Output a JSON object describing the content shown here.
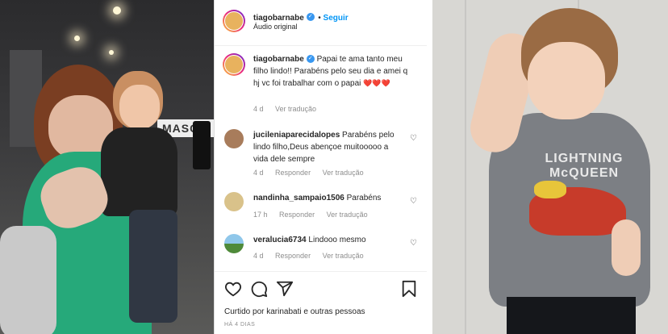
{
  "header": {
    "username": "tiagobarnabe",
    "follow_label": "Seguir",
    "audio_label": "Áudio original"
  },
  "caption": {
    "username": "tiagobarnabe",
    "text": "Papai te ama tanto meu filho lindo!! Parabéns pelo seu dia e amei q hj vc foi trabalhar com o papai",
    "hearts": "❤️❤️❤️",
    "time": "4 d",
    "translate_label": "Ver tradução"
  },
  "comments": [
    {
      "username": "jucileniaparecidalopes",
      "text": "Parabéns pelo lindo filho,Deus abençoe muitooooo a vida dele sempre",
      "time": "4 d",
      "reply_label": "Responder",
      "translate_label": "Ver tradução"
    },
    {
      "username": "nandinha_sampaio1506",
      "text": "Parabéns",
      "time": "17 h",
      "reply_label": "Responder",
      "translate_label": "Ver tradução"
    },
    {
      "username": "veralucia6734",
      "text": "Lindooo mesmo",
      "time": "4 d",
      "reply_label": "Responder",
      "translate_label": "Ver tradução"
    }
  ],
  "footer": {
    "likes_text": "Curtido por karinabati e outras pessoas",
    "date_text": "HÁ 4 DIAS"
  },
  "left_photo": {
    "sign_text": "MASCU"
  },
  "right_photo": {
    "shirt_line1": "LIGHTNING",
    "shirt_line2": "McQUEEN"
  },
  "colors": {
    "link_blue": "#0095f6",
    "verified_blue": "#3897f0",
    "heart_red": "#ed4956",
    "muted": "#8e8e8e"
  }
}
